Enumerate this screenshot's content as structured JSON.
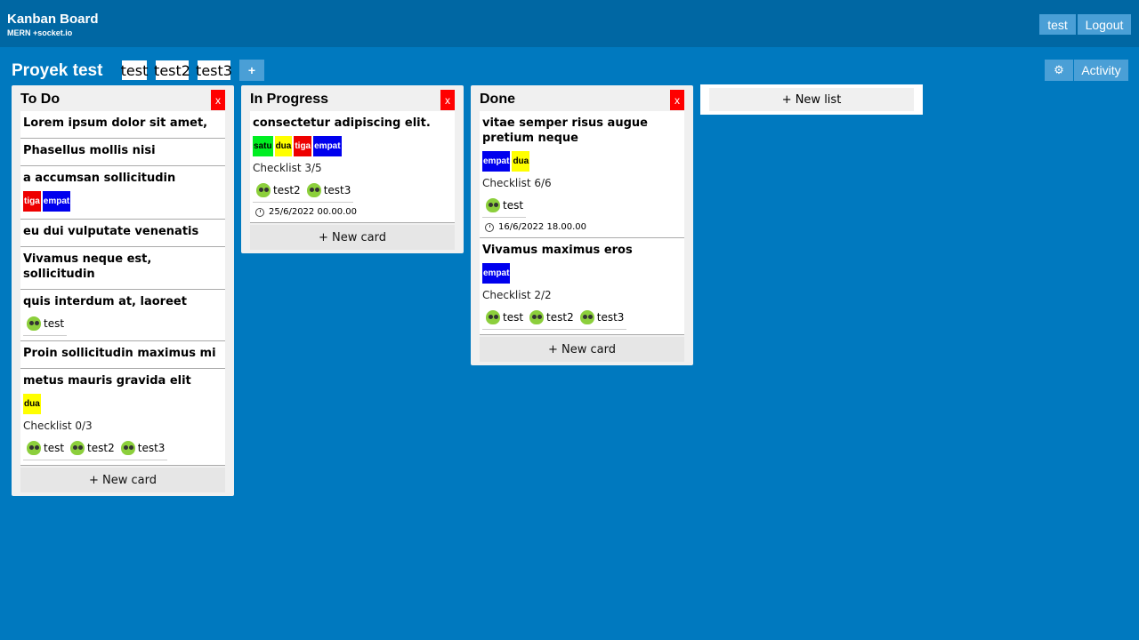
{
  "app": {
    "title": "Kanban Board",
    "subtitle": "MERN +socket.io"
  },
  "header": {
    "user_label": "test",
    "logout_label": "Logout"
  },
  "project": {
    "title": "Proyek test",
    "members": [
      "test",
      "test2",
      "test3"
    ],
    "add_member_label": "+",
    "settings_icon": "gear-icon",
    "activity_label": "Activity"
  },
  "colors": {
    "background": "#0079bf",
    "topbar": "#0067a3",
    "button": "#4a9fd6",
    "delete": "#ff0000",
    "label_satu": "#00ee22",
    "label_dua": "#ffff00",
    "label_tiga": "#ee0000",
    "label_empat": "#0000ee"
  },
  "lists": [
    {
      "title": "To Do",
      "delete_label": "x",
      "new_card_label": "+ New card",
      "cards": [
        {
          "title": "Lorem ipsum dolor sit amet,"
        },
        {
          "title": "Phasellus mollis nisi"
        },
        {
          "title": "a accumsan sollicitudin",
          "labels": [
            "tiga",
            "empat"
          ]
        },
        {
          "title": "eu dui vulputate venenatis"
        },
        {
          "title": "Vivamus neque est, sollicitudin"
        },
        {
          "title": "quis interdum at, laoreet",
          "members": [
            "test"
          ]
        },
        {
          "title": "Proin sollicitudin maximus mi"
        },
        {
          "title": "metus mauris gravida elit",
          "labels": [
            "dua"
          ],
          "checklist": "Checklist 0/3",
          "members": [
            "test",
            "test2",
            "test3"
          ]
        }
      ]
    },
    {
      "title": "In Progress",
      "delete_label": "x",
      "new_card_label": "+ New card",
      "cards": [
        {
          "title": "consectetur adipiscing elit.",
          "labels": [
            "satu",
            "dua",
            "tiga",
            "empat"
          ],
          "checklist": "Checklist 3/5",
          "members": [
            "test2",
            "test3"
          ],
          "due": "25/6/2022 00.00.00"
        }
      ]
    },
    {
      "title": "Done",
      "delete_label": "x",
      "new_card_label": "+ New card",
      "cards": [
        {
          "title": "vitae semper risus augue pretium neque",
          "labels": [
            "empat",
            "dua"
          ],
          "checklist": "Checklist 6/6",
          "members": [
            "test"
          ],
          "due": "16/6/2022 18.00.00"
        },
        {
          "title": "Vivamus maximus eros",
          "labels": [
            "empat"
          ],
          "checklist": "Checklist 2/2",
          "members": [
            "test",
            "test2",
            "test3"
          ]
        }
      ]
    }
  ],
  "new_list_label": "+ New list"
}
